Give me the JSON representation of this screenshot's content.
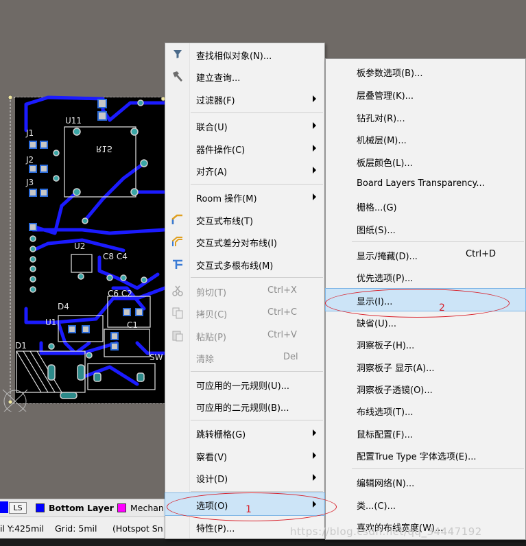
{
  "context_menu": {
    "items": [
      {
        "label": "查找相似对象(N)...",
        "icon": "funnel-icon"
      },
      {
        "label": "建立查询...",
        "icon": "hammer-icon"
      },
      {
        "label": "过滤器(F)",
        "submenu": true
      },
      {
        "label": "联合(U)",
        "submenu": true
      },
      {
        "label": "器件操作(C)",
        "submenu": true
      },
      {
        "label": "对齐(A)",
        "submenu": true
      },
      {
        "label": "Room 操作(M)",
        "submenu": true
      },
      {
        "label": "交互式布线(T)",
        "icon": "route-icon"
      },
      {
        "label": "交互式差分对布线(I)",
        "icon": "diff-route-icon"
      },
      {
        "label": "交互式多根布线(M)",
        "icon": "multi-route-icon"
      },
      {
        "label": "剪切(T)",
        "shortcut": "Ctrl+X",
        "disabled": true,
        "icon": "scissors-icon"
      },
      {
        "label": "拷贝(C)",
        "shortcut": "Ctrl+C",
        "disabled": true,
        "icon": "copy-icon"
      },
      {
        "label": "粘贴(P)",
        "shortcut": "Ctrl+V",
        "disabled": true,
        "icon": "paste-icon"
      },
      {
        "label": "清除",
        "shortcut": "Del",
        "disabled": true
      },
      {
        "label": "可应用的一元规则(U)..."
      },
      {
        "label": "可应用的二元规则(B)..."
      },
      {
        "label": "跳转栅格(G)",
        "submenu": true
      },
      {
        "label": "察看(V)",
        "submenu": true
      },
      {
        "label": "设计(D)",
        "submenu": true
      },
      {
        "label": "选项(O)",
        "submenu": true,
        "highlighted": true
      },
      {
        "label": "特性(P)..."
      }
    ]
  },
  "submenu": {
    "items": [
      {
        "label": "板参数选项(B)..."
      },
      {
        "label": "层叠管理(K)..."
      },
      {
        "label": "钻孔对(R)..."
      },
      {
        "label": "机械层(M)..."
      },
      {
        "label": "板层颜色(L)..."
      },
      {
        "label": "Board Layers Transparency..."
      },
      {
        "label": "栅格...(G)"
      },
      {
        "label": "图纸(S)..."
      },
      {
        "label": "显示/掩藏(D)...",
        "shortcut": "Ctrl+D"
      },
      {
        "label": "优先选项(P)..."
      },
      {
        "label": "显示(I)...",
        "highlighted": true
      },
      {
        "label": "缺省(U)..."
      },
      {
        "label": "洞察板子(H)..."
      },
      {
        "label": "洞察板子 显示(A)..."
      },
      {
        "label": "洞察板子透镜(O)..."
      },
      {
        "label": "布线选项(T)..."
      },
      {
        "label": "鼠标配置(F)..."
      },
      {
        "label": "配置True Type 字体选项(E)..."
      },
      {
        "label": "编辑网络(N)..."
      },
      {
        "label": "类...(C)..."
      },
      {
        "label": "喜欢的布线宽度(W)..."
      }
    ]
  },
  "pcb_labels": {
    "u11": "U11",
    "u11_mirror": "R1S",
    "j1": "J1",
    "j2": "J2",
    "j3": "J3",
    "u2": "U2",
    "c8c4": "C8 C4",
    "c6c2": "C6 C2",
    "d4": "D4",
    "u1": "U1",
    "c1": "C1",
    "d1": "D1",
    "sw": "SW"
  },
  "layer_tabs": {
    "ls": "LS",
    "bottom": "Bottom Layer",
    "mech": "Mechan",
    "bottom_color": "#0000ff",
    "mech_color": "#ff00ff"
  },
  "status": {
    "y": "il Y:425mil",
    "grid": "Grid: 5mil",
    "hotspot": "(Hotspot Sn"
  },
  "annotations": {
    "one": "1",
    "two": "2"
  },
  "watermark": "https://blog.csdn.net/qq_34447192"
}
